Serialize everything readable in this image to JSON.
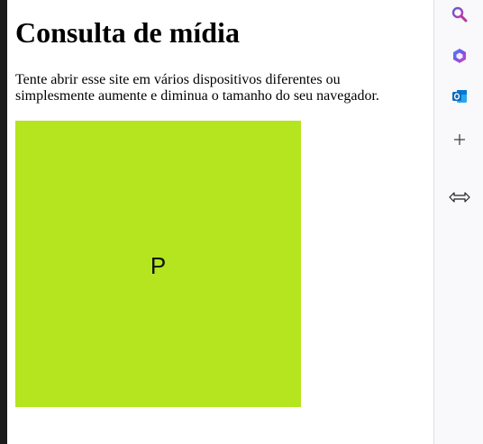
{
  "page": {
    "title": "Consulta de mídia",
    "description": "Tente abrir esse site em vários dispositivos diferentes ou simplesmente aumente e diminua o tamanho do seu navegador.",
    "box_text": "P",
    "box_color": "#b4e51f"
  },
  "sidebar": {
    "icons": [
      "search-icon",
      "copilot-icon",
      "outlook-icon",
      "add-icon",
      "resize-horizontal-icon"
    ],
    "colors": {
      "copilot_start": "#6a4cf5",
      "copilot_end": "#e048a8",
      "outlook": "#0f6cbd"
    }
  }
}
